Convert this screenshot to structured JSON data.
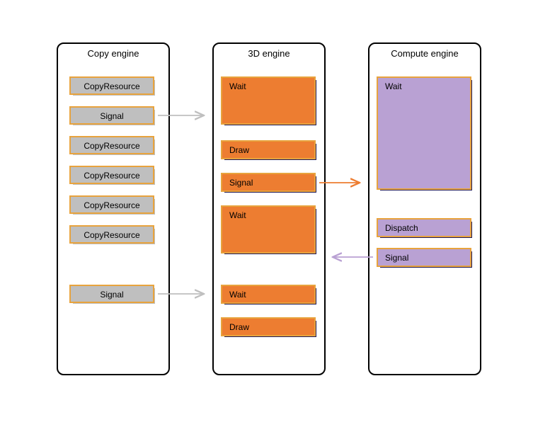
{
  "engines": {
    "copy": {
      "title": "Copy engine"
    },
    "d3": {
      "title": "3D engine"
    },
    "compute": {
      "title": "Compute engine"
    }
  },
  "copy_ops": [
    {
      "label": "CopyResource"
    },
    {
      "label": "Signal"
    },
    {
      "label": "CopyResource"
    },
    {
      "label": "CopyResource"
    },
    {
      "label": "CopyResource"
    },
    {
      "label": "CopyResource"
    },
    {
      "label": "Signal"
    }
  ],
  "d3_ops": [
    {
      "label": "Wait"
    },
    {
      "label": "Draw"
    },
    {
      "label": "Signal"
    },
    {
      "label": "Wait"
    },
    {
      "label": "Wait"
    },
    {
      "label": "Draw"
    }
  ],
  "compute_ops": [
    {
      "label": "Wait"
    },
    {
      "label": "Dispatch"
    },
    {
      "label": "Signal"
    }
  ]
}
